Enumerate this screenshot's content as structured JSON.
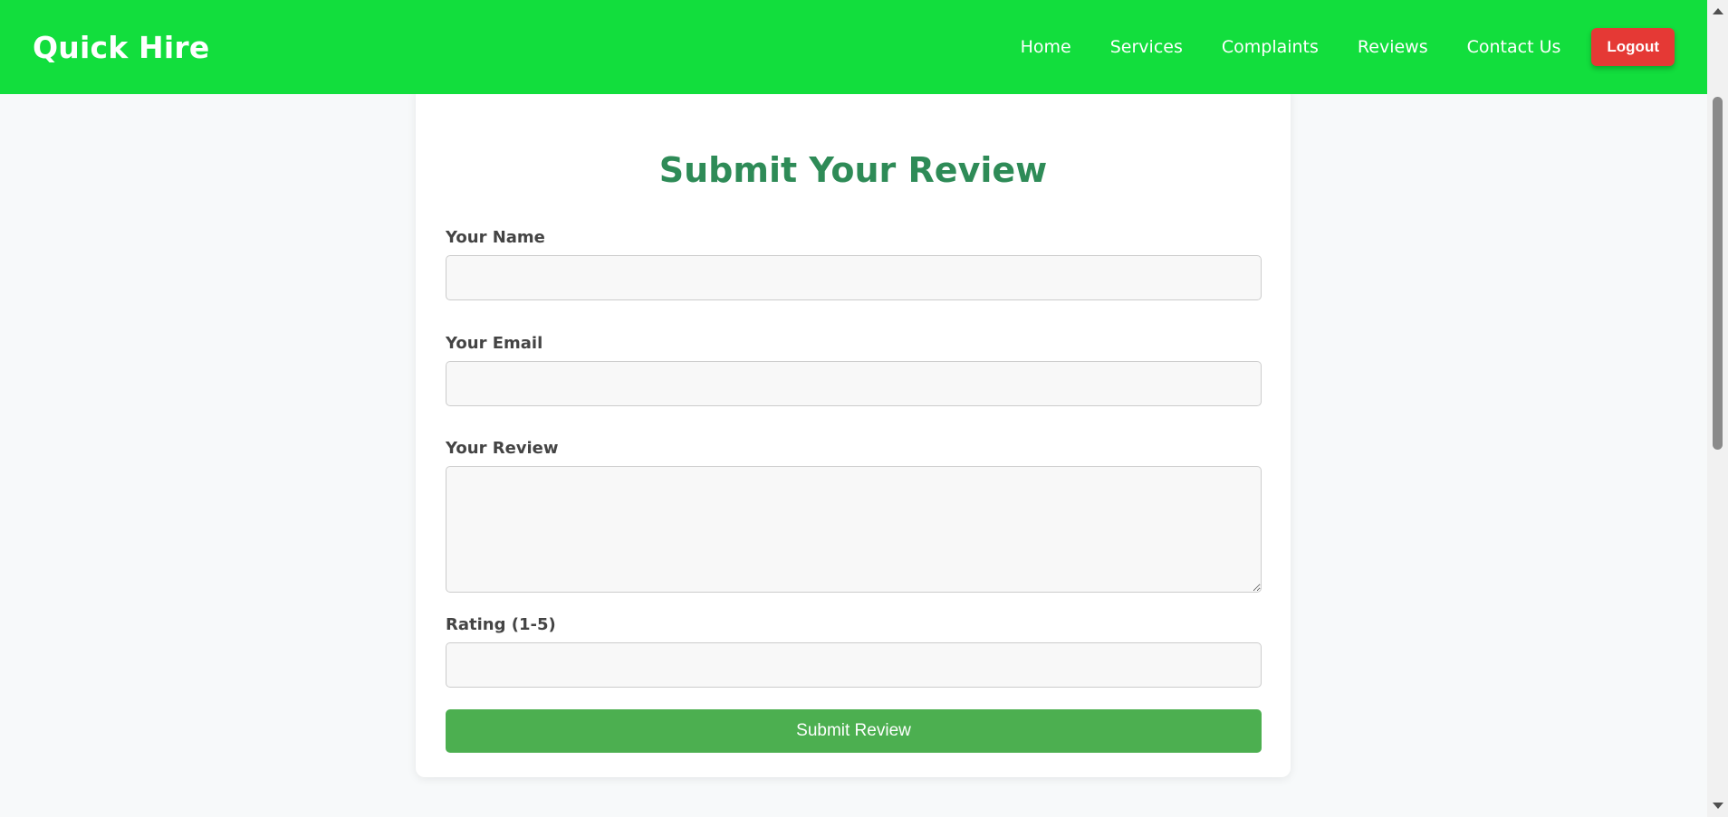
{
  "header": {
    "brand": "Quick Hire",
    "nav": [
      "Home",
      "Services",
      "Complaints",
      "Reviews",
      "Contact Us"
    ],
    "logout_label": "Logout"
  },
  "form": {
    "title": "Submit Your Review",
    "name_label": "Your Name",
    "email_label": "Your Email",
    "review_label": "Your Review",
    "rating_label": "Rating (1-5)",
    "submit_label": "Submit Review"
  },
  "colors": {
    "header_bg": "#12de3d",
    "title": "#2e8b57",
    "logout": "#e53935",
    "submit": "#4caf50"
  }
}
